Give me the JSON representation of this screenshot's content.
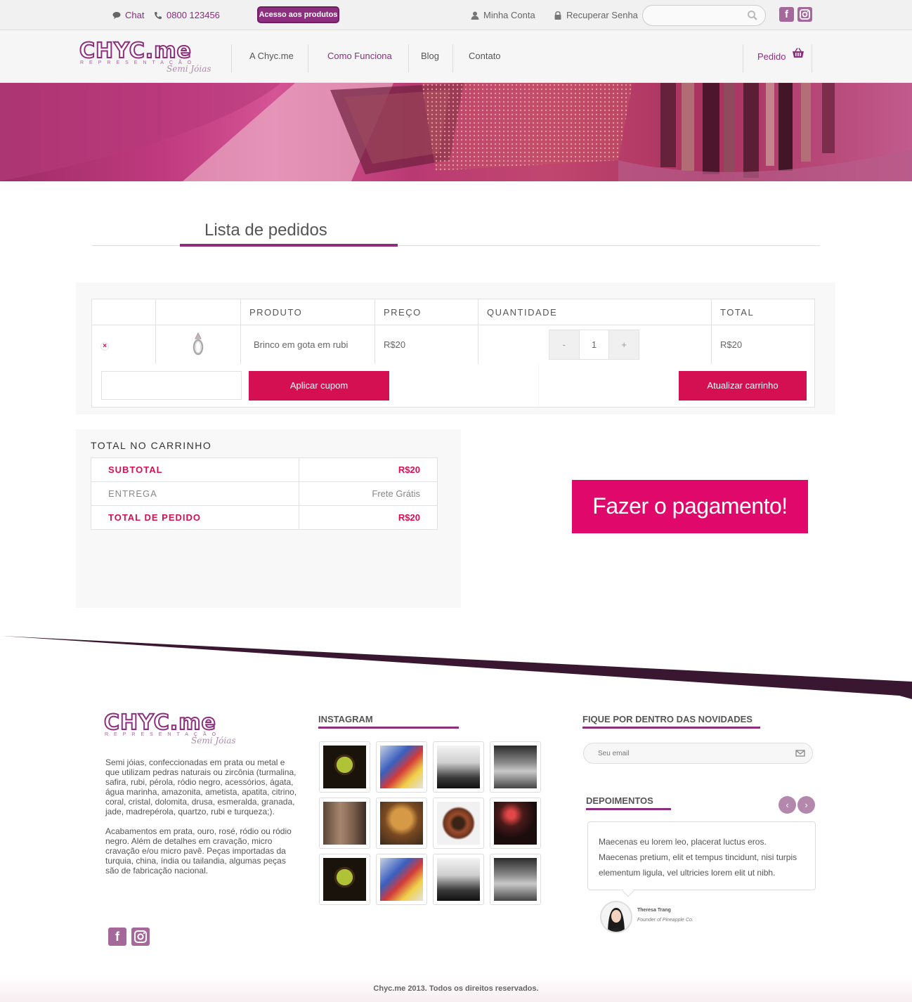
{
  "topbar": {
    "chat_label": "Chat",
    "phone": "0800 123456",
    "access_button": "Acesso aos produtos",
    "account_label": "Minha Conta",
    "recover_label": "Recuperar Senha",
    "search_placeholder": "",
    "social": [
      "f",
      "instagram"
    ]
  },
  "header": {
    "logo_brand": "CHYC.me",
    "logo_sub": "REPRESENTAÇÃO",
    "logo_tag": "Semi Jóias",
    "nav": [
      "A Chyc.me",
      "Como Funciona",
      "Blog",
      "Contato"
    ],
    "nav_active": "Como Funciona",
    "cart_label": "Pedido"
  },
  "page": {
    "title": "Lista de pedidos"
  },
  "cart": {
    "columns": [
      "",
      "",
      "PRODUTO",
      "PREÇO",
      "QUANTIDADE",
      "TOTAL"
    ],
    "rows": [
      {
        "product": "Brinco em gota em rubi",
        "price": "R$20",
        "quantity": "1",
        "total": "R$20"
      }
    ],
    "minus": "-",
    "plus": "+",
    "coupon_placeholder": "",
    "apply_coupon": "Aplicar cupom",
    "update_cart": "Atualizar carrinho"
  },
  "totals": {
    "title": "TOTAL NO CARRINHO",
    "subtotal_label": "SUBTOTAL",
    "subtotal_value": "R$20",
    "shipping_label": "ENTREGA",
    "shipping_value": "Frete Grátis",
    "order_total_label": "TOTAL DE PEDIDO",
    "order_total_value": "R$20"
  },
  "checkout_button": "Fazer o pagamento!",
  "footer": {
    "about_p1": "Semi jóias, confeccionadas em prata ou metal e que utilizam pedras naturais ou zircônia (turmalina, safira, rubi, pérola, ródio negro, acessórios, ágata, água marinha, amazonita, ametista, apatita, citrino, coral, cristal, dolomita, drusa, esmeralda, granada, jade, madrepérola, quartzo, rubi e turqueza;).",
    "about_p2": "Acabamentos em prata, ouro, rosé, ródio ou ródio negro. Além de detalhes em cravação, micro cravação e/ou micro pavê. Peças importadas da turquia, china, índia ou tailandia, algumas peças são de fabricação nacional.",
    "instagram_title": "INSTAGRAM",
    "newsletter_title": "FIQUE POR DENTRO DAS NOVIDADES",
    "email_placeholder": "Seu email",
    "testimonials_title": "DEPOIMENTOS",
    "testimonial_text": "Maecenas eu lorem leo, placerat luctus eros. Maecenas pretium, elit et tempus tincidunt, nisi turpis elementum ligula, vel ultricies lorem elit ut nibh.",
    "testimonial_name": "Theresa Trang",
    "testimonial_role": "Founder of Pineapple Co.",
    "copyright": "Chyc.me 2013. Todos os direitos reservados."
  },
  "colors": {
    "brand_purple": "#8d2e7f",
    "accent_pink": "#d40f52",
    "pay_pink": "#e0086a"
  }
}
